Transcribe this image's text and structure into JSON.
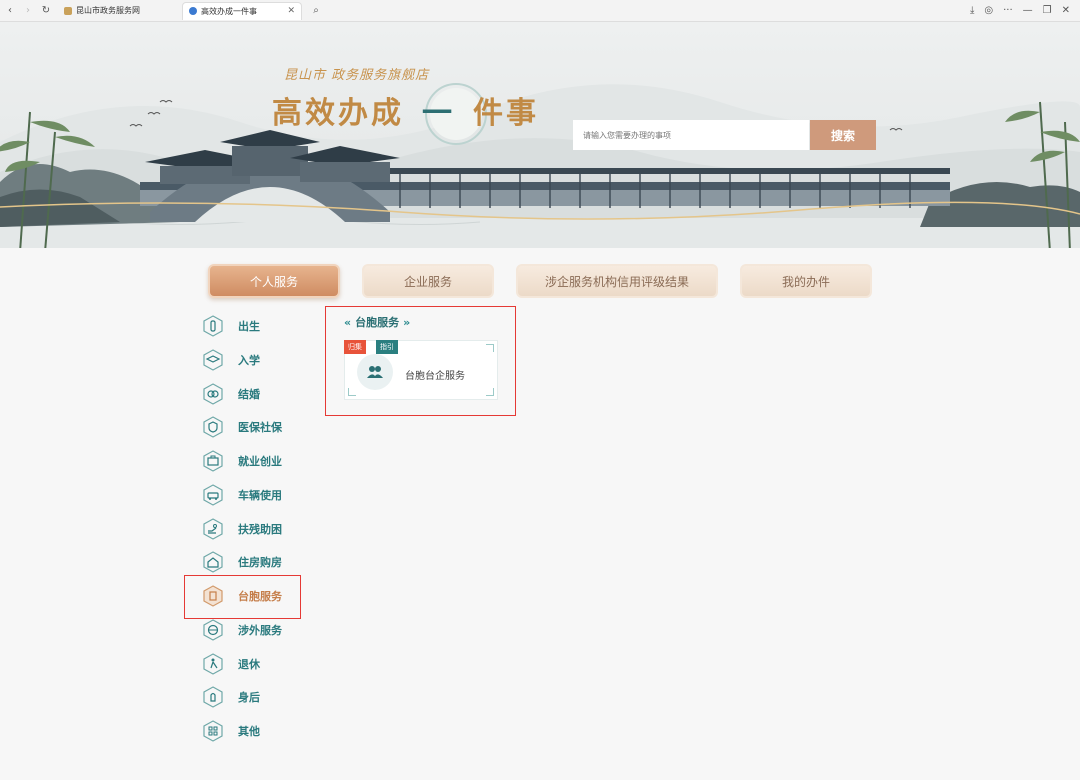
{
  "browser": {
    "tabs": [
      {
        "label": "昆山市政务服务网"
      },
      {
        "label": "高效办成一件事"
      }
    ]
  },
  "banner": {
    "subtitle": "昆山市 政务服务旗舰店",
    "title_a": "高效办成",
    "title_b": "一",
    "title_c": "件事",
    "search_placeholder": "请输入您需要办理的事项",
    "search_button": "搜索"
  },
  "main_tabs": [
    {
      "label": "个人服务",
      "active": true
    },
    {
      "label": "企业服务",
      "active": false
    },
    {
      "label": "涉企服务机构信用评级结果",
      "active": false
    },
    {
      "label": "我的办件",
      "active": false
    }
  ],
  "sidebar": {
    "items": [
      {
        "label": "出生",
        "icon": "baby-bottle-icon"
      },
      {
        "label": "入学",
        "icon": "school-hat-icon"
      },
      {
        "label": "结婚",
        "icon": "rings-icon"
      },
      {
        "label": "医保社保",
        "icon": "shield-icon"
      },
      {
        "label": "就业创业",
        "icon": "briefcase-icon"
      },
      {
        "label": "车辆使用",
        "icon": "car-icon"
      },
      {
        "label": "扶残助困",
        "icon": "helping-hand-icon"
      },
      {
        "label": "住房购房",
        "icon": "house-icon"
      },
      {
        "label": "台胞服务",
        "icon": "document-icon",
        "active": true
      },
      {
        "label": "涉外服务",
        "icon": "globe-icon"
      },
      {
        "label": "退休",
        "icon": "elderly-icon"
      },
      {
        "label": "身后",
        "icon": "memorial-icon"
      },
      {
        "label": "其他",
        "icon": "grid-icon"
      }
    ]
  },
  "panel": {
    "title": "台胞服务",
    "card": {
      "badge_red": "归集",
      "badge_teal": "指引",
      "label": "台胞台企服务"
    }
  },
  "colors": {
    "accent_teal": "#2a7a7e",
    "accent_orange": "#cf8c62",
    "highlight_red": "#e53935"
  }
}
